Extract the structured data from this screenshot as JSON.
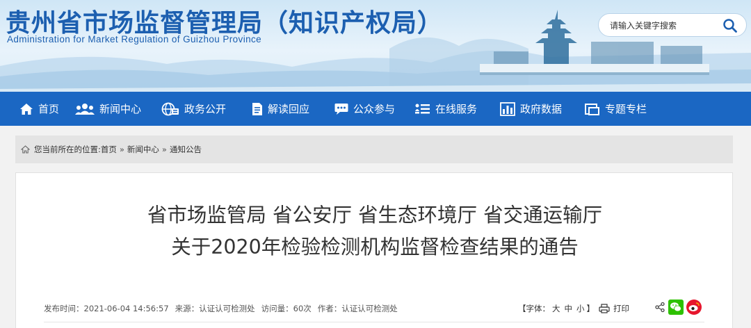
{
  "header": {
    "title": "贵州省市场监督管理局（知识产权局）",
    "subtitle": "Administration for Market Regulation of Guizhou Province",
    "search_placeholder": "请输入关键字搜索"
  },
  "nav": {
    "items": [
      {
        "label": "首页",
        "icon": "home-icon"
      },
      {
        "label": "新闻中心",
        "icon": "people-icon"
      },
      {
        "label": "政务公开",
        "icon": "globe-icon"
      },
      {
        "label": "解读回应",
        "icon": "document-icon"
      },
      {
        "label": "公众参与",
        "icon": "chat-icon"
      },
      {
        "label": "在线服务",
        "icon": "list-icon"
      },
      {
        "label": "政府数据",
        "icon": "bar-chart-icon"
      },
      {
        "label": "专题专栏",
        "icon": "window-icon"
      }
    ]
  },
  "breadcrumb": {
    "prefix": "您当前所在的位置: ",
    "items": [
      "首页",
      "新闻中心",
      "通知公告"
    ],
    "separator": "»"
  },
  "article": {
    "title_line1": "省市场监管局 省公安厅 省生态环境厅 省交通运输厅",
    "title_line2": "关于2020年检验检测机构监督检查结果的通告",
    "publish_time": "发布时间：2021-06-04 14:56:57",
    "source": "来源：认证认可检测处",
    "views": "访问量：60次",
    "author": "作者：认证认可检测处",
    "font_label": "【字体：",
    "font_large": "大",
    "font_medium": "中",
    "font_small": "小",
    "font_close": "】",
    "print_label": "打印"
  },
  "colors": {
    "brand_blue": "#1b67c3",
    "title_blue": "#1c5fb0",
    "wechat_green": "#2dc100",
    "weibo_red": "#e6162d"
  }
}
